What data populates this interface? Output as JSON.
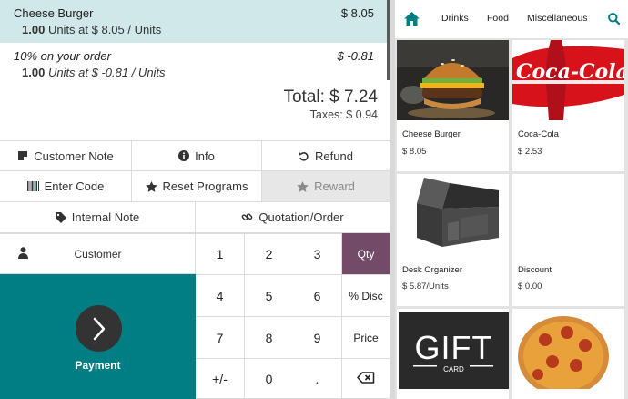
{
  "order": {
    "lines": [
      {
        "name": "Cheese Burger",
        "price": "$ 8.05",
        "qty": "1.00",
        "detail": "Units at $ 8.05 / Units"
      },
      {
        "name": "10% on your order",
        "price": "$ -0.81",
        "qty": "1.00",
        "detail": "Units at $ -0.81 / Units"
      }
    ],
    "total": "Total: $ 7.24",
    "taxes": "Taxes: $ 0.94"
  },
  "actions": {
    "customer_note": "Customer Note",
    "info": "Info",
    "refund": "Refund",
    "enter_code": "Enter Code",
    "reset_programs": "Reset Programs",
    "reward": "Reward",
    "internal_note": "Internal Note",
    "quotation_order": "Quotation/Order"
  },
  "customer_label": "Customer",
  "payment_label": "Payment",
  "numpad": {
    "keys": [
      "1",
      "2",
      "3",
      "4",
      "5",
      "6",
      "7",
      "8",
      "9",
      "+/-",
      "0",
      "."
    ],
    "modes": [
      "Qty",
      "% Disc",
      "Price"
    ],
    "active_mode": "Qty"
  },
  "categories": [
    "Drinks",
    "Food",
    "Miscellaneous"
  ],
  "products": [
    {
      "name": "Cheese Burger",
      "price": "$ 8.05"
    },
    {
      "name": "Coca-Cola",
      "price": "$ 2.53"
    },
    {
      "name": "Desk Organizer",
      "price": "$ 5.87/Units"
    },
    {
      "name": "Discount",
      "price": "$ 0.00"
    },
    {
      "name": "Gift Card",
      "price": "",
      "image_text": "GIFT",
      "image_subtext": "CARD"
    },
    {
      "name": "Pizza",
      "price": ""
    }
  ],
  "coca_cola_logo": "Coca-Cola",
  "colors": {
    "selected_line": "#d0e8ea",
    "payment": "#017e84",
    "active_mode": "#714b67",
    "brand_teal": "#017e84"
  },
  "icons": {
    "customer_note": "note-icon",
    "info": "info-icon",
    "refund": "undo-icon",
    "enter_code": "barcode-icon",
    "reset_programs": "star-icon",
    "reward": "star-icon",
    "internal_note": "tag-icon",
    "quotation_order": "link-icon",
    "customer": "user-icon",
    "payment": "chevron-right-icon",
    "backspace": "backspace-icon",
    "home": "home-icon",
    "search": "search-icon"
  }
}
